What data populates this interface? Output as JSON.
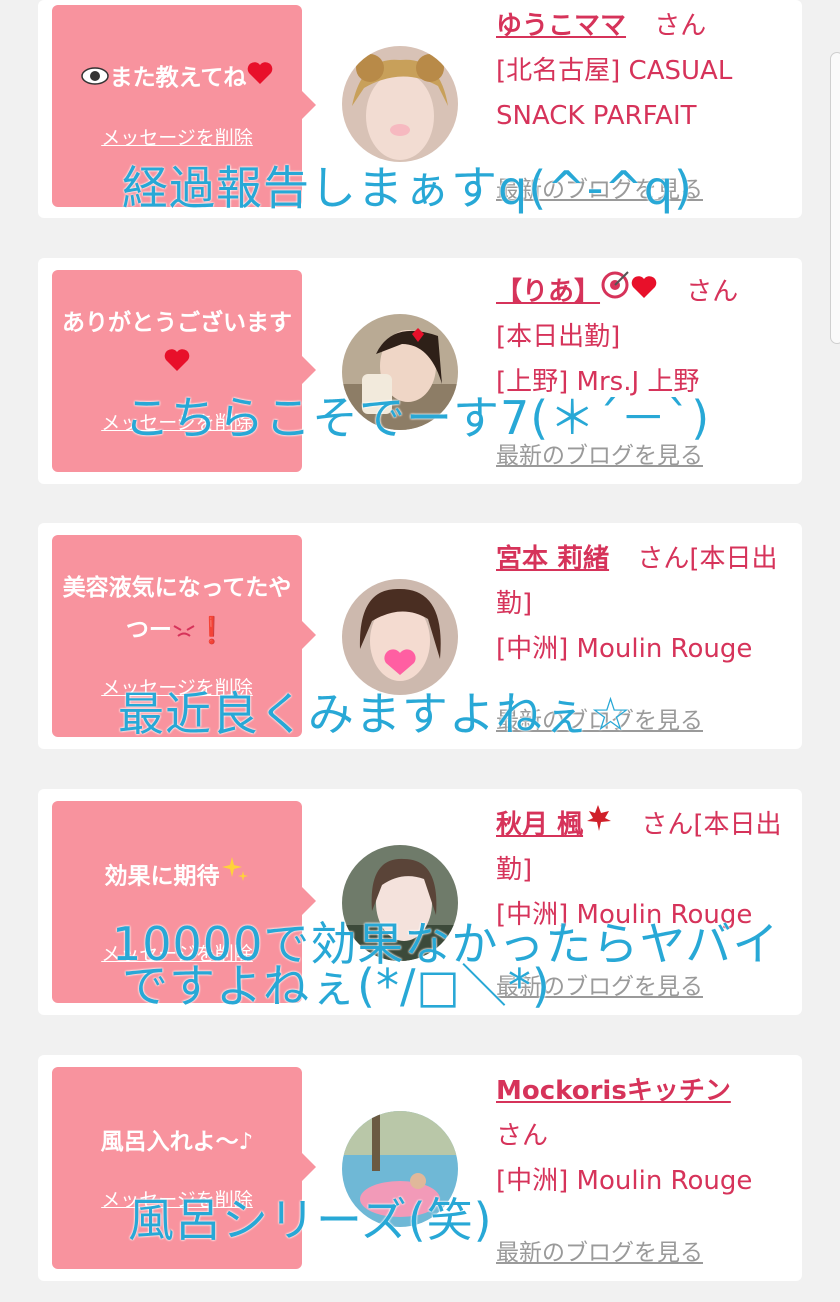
{
  "cards": [
    {
      "message": "また教えてね",
      "delete_label": "メッセージを削除",
      "name": "ゆうこママ",
      "san": "さん",
      "detail": "[北名古屋] CASUAL SNACK PARFAIT",
      "blog_label": "最新のブログを見る",
      "overlay": "経過報告しまぁすq(^-^q)"
    },
    {
      "message": "ありがとうございます",
      "delete_label": "メッセージを削除",
      "name": "【りあ】",
      "san": "さん",
      "detail": "[本日出勤]",
      "detail2": "[上野] Mrs.J 上野",
      "blog_label": "最新のブログを見る",
      "overlay": "こちらこそでーす7(＊´－`)"
    },
    {
      "message": "美容液気になってたやつー",
      "delete_label": "メッセージを削除",
      "name": "宮本 莉緒",
      "san": "さん[本日出勤]",
      "detail": "[中洲] Moulin Rouge",
      "blog_label": "最新のブログを見る",
      "overlay": "最近良くみますよねぇ☆"
    },
    {
      "message": "効果に期待",
      "delete_label": "メッセージを削除",
      "name": "秋月 楓",
      "san": "さん[本日出勤]",
      "detail": "[中洲] Moulin Rouge",
      "blog_label": "最新のブログを見る",
      "overlay": "10000で効果なかったらヤバイ",
      "overlay2": "ですよねぇ(*/□＼*)"
    },
    {
      "message": "風呂入れよ～♪",
      "delete_label": "メッセージを削除",
      "name": "Mockorisキッチン",
      "san": "さん",
      "detail": "[中洲] Moulin Rouge",
      "blog_label": "最新のブログを見る",
      "overlay": "風呂シリーズ(笑)"
    }
  ],
  "icons": {
    "eye": "eye-icon",
    "heart": "heart-icon",
    "target": "target-icon",
    "frown": "frown-icon",
    "exclamation": "exclamation-icon",
    "sparkles": "sparkles-icon",
    "maple": "maple-leaf-icon"
  },
  "colors": {
    "bubble": "#f8939e",
    "name": "#d6335a",
    "overlay": "#28a8d6",
    "link_gray": "#9a9a9a",
    "background": "#f1f1f1"
  }
}
